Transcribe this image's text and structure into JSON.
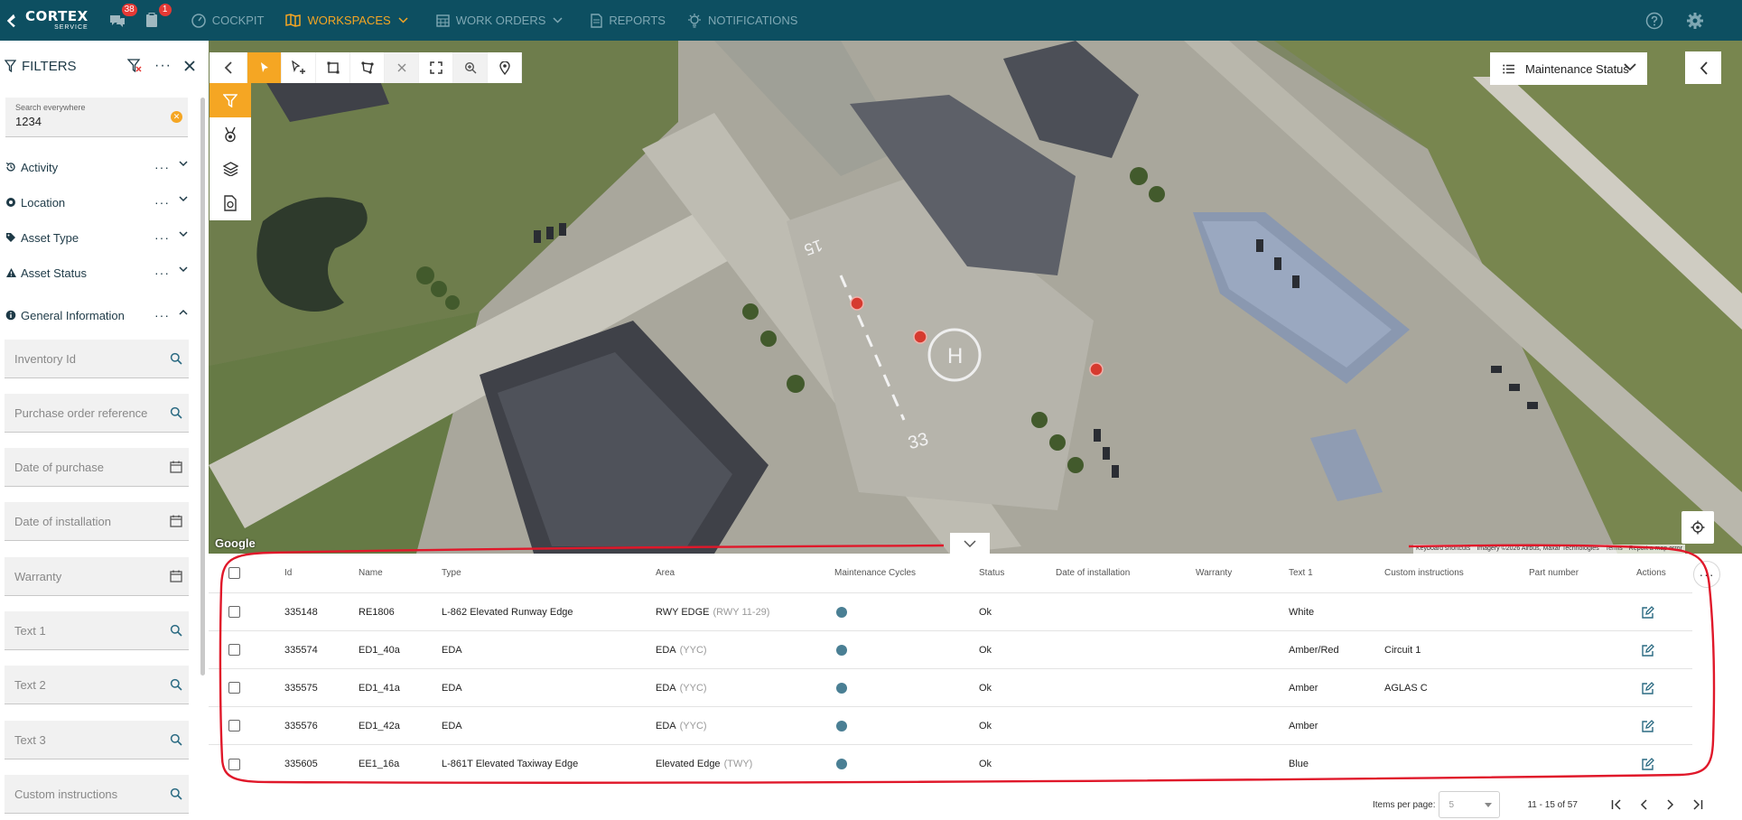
{
  "nav": {
    "brand_name": "CORTEX",
    "brand_sub": "SERVICE",
    "messages_count": "38",
    "tasks_count": "1",
    "items": [
      {
        "label": "COCKPIT"
      },
      {
        "label": "WORKSPACES"
      },
      {
        "label": "WORK ORDERS"
      },
      {
        "label": "REPORTS"
      },
      {
        "label": "NOTIFICATIONS"
      }
    ],
    "active": "WORKSPACES"
  },
  "filters": {
    "title": "FILTERS",
    "search": {
      "label": "Search everywhere",
      "value": "1234"
    },
    "sections": [
      {
        "label": "Activity",
        "icon": "history-icon"
      },
      {
        "label": "Location",
        "icon": "location-pin-icon"
      },
      {
        "label": "Asset Type",
        "icon": "tag-icon"
      },
      {
        "label": "Asset Status",
        "icon": "warning-icon"
      },
      {
        "label": "General Information",
        "icon": "info-icon"
      }
    ],
    "fields": [
      {
        "placeholder": "Inventory Id",
        "icon": "search-icon"
      },
      {
        "placeholder": "Purchase order reference",
        "icon": "search-icon"
      },
      {
        "placeholder": "Date of purchase",
        "icon": "calendar-icon"
      },
      {
        "placeholder": "Date of installation",
        "icon": "calendar-icon"
      },
      {
        "placeholder": "Warranty",
        "icon": "calendar-icon"
      },
      {
        "placeholder": "Text 1",
        "icon": "search-icon"
      },
      {
        "placeholder": "Text 2",
        "icon": "search-icon"
      },
      {
        "placeholder": "Text 3",
        "icon": "search-icon"
      },
      {
        "placeholder": "Custom instructions",
        "icon": "search-icon"
      }
    ]
  },
  "map": {
    "layer_select": "Maintenance Status",
    "google_label": "Google",
    "attribution": [
      "Keyboard shortcuts",
      "Imagery ©2026 Airbus, Maxar Technologies",
      "Terms",
      "Report a map error"
    ],
    "heli_label": "H",
    "runway_labels": [
      "15",
      "33"
    ]
  },
  "table": {
    "columns": [
      "Id",
      "Name",
      "Type",
      "Area",
      "Maintenance Cycles",
      "Status",
      "Date of installation",
      "Warranty",
      "Text 1",
      "Custom instructions",
      "Part number",
      "Actions"
    ],
    "rows": [
      {
        "id": "335148",
        "name": "RE1806",
        "type": "L-862 Elevated Runway Edge",
        "area": "RWY EDGE",
        "area_sub": "(RWY 11-29)",
        "status": "Ok",
        "date_of_installation": "",
        "warranty": "",
        "text1": "White",
        "custom": "",
        "part": ""
      },
      {
        "id": "335574",
        "name": "ED1_40a",
        "type": "EDA",
        "area": "EDA",
        "area_sub": "(YYC)",
        "status": "Ok",
        "date_of_installation": "",
        "warranty": "",
        "text1": "Amber/Red",
        "custom": "Circuit 1",
        "part": ""
      },
      {
        "id": "335575",
        "name": "ED1_41a",
        "type": "EDA",
        "area": "EDA",
        "area_sub": "(YYC)",
        "status": "Ok",
        "date_of_installation": "",
        "warranty": "",
        "text1": "Amber",
        "custom": "AGLAS C",
        "part": ""
      },
      {
        "id": "335576",
        "name": "ED1_42a",
        "type": "EDA",
        "area": "EDA",
        "area_sub": "(YYC)",
        "status": "Ok",
        "date_of_installation": "",
        "warranty": "",
        "text1": "Amber",
        "custom": "",
        "part": ""
      },
      {
        "id": "335605",
        "name": "EE1_16a",
        "type": "L-861T Elevated Taxiway Edge",
        "area": "Elevated Edge",
        "area_sub": "(TWY)",
        "status": "Ok",
        "date_of_installation": "",
        "warranty": "",
        "text1": "Blue",
        "custom": "",
        "part": ""
      }
    ],
    "pager": {
      "label": "Items per page:",
      "per_page": "5",
      "range": "11 - 15 of 57"
    }
  },
  "colors": {
    "nav_bg": "#0d4f61",
    "accent": "#f5a623",
    "maintenance_dot": "#4a7f94",
    "map_marker": "#d63a2f",
    "annotation": "#e0182a"
  }
}
